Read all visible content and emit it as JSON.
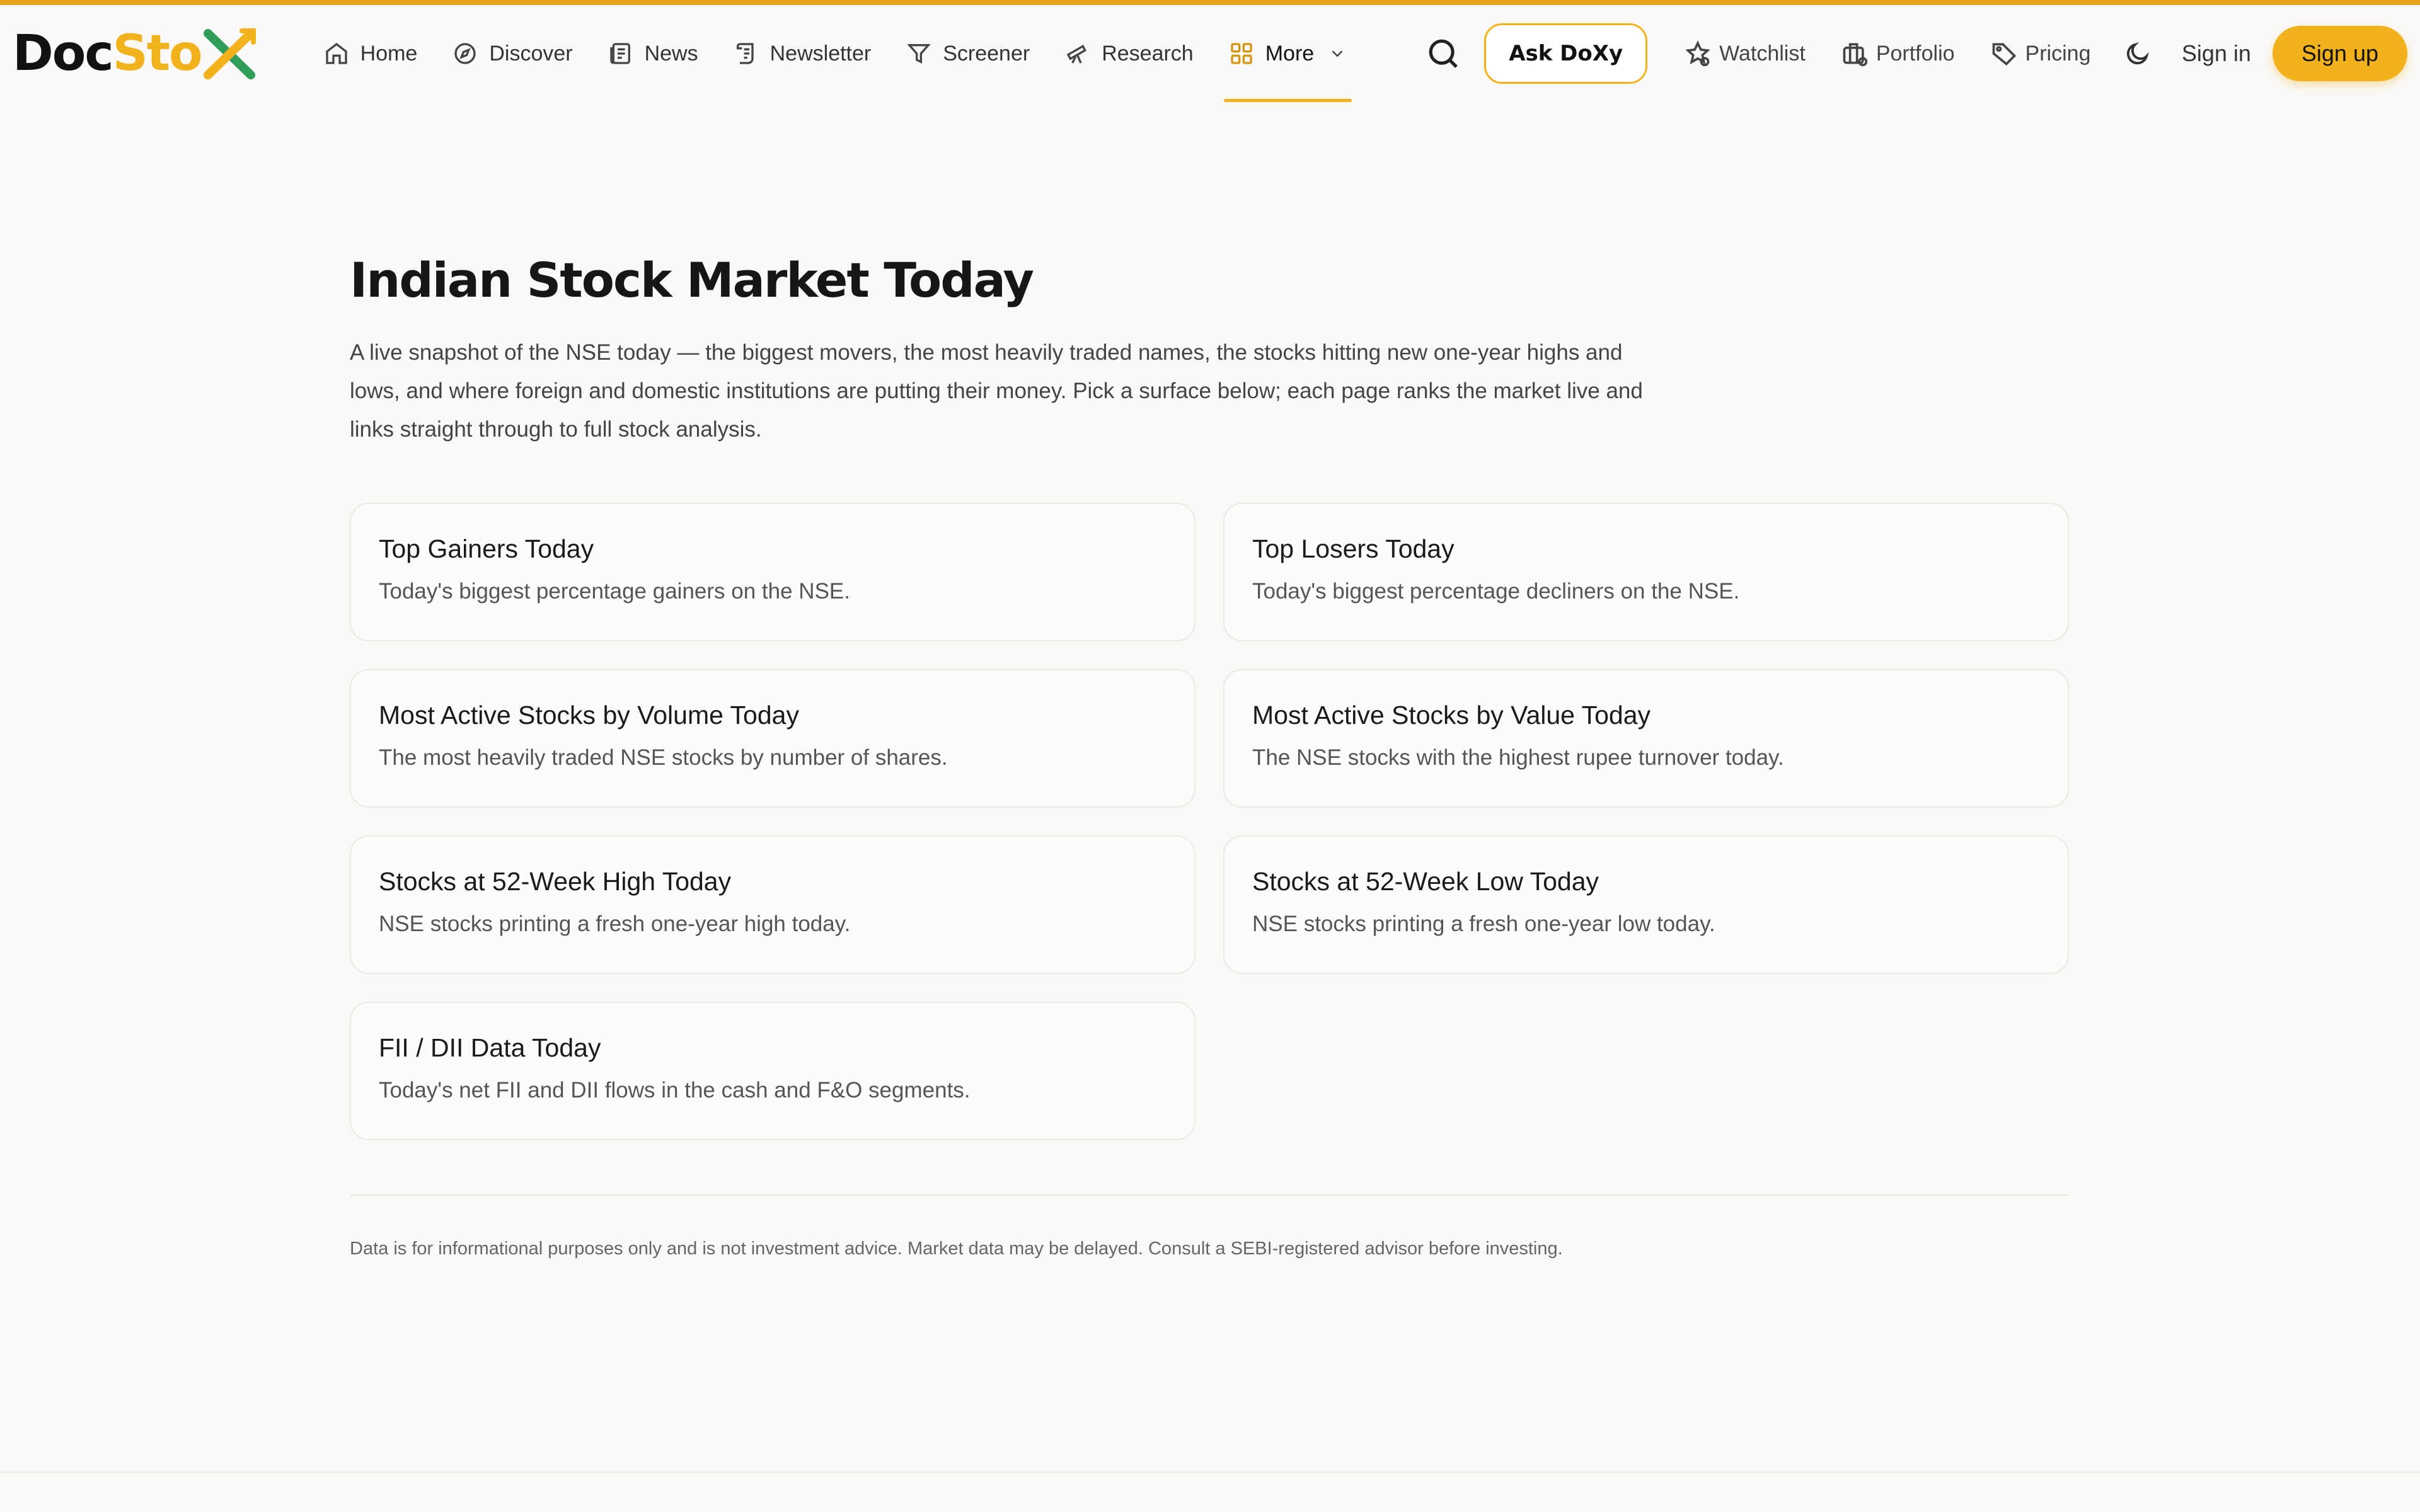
{
  "brand": {
    "part1": "Doc",
    "part2": "Sto",
    "part3": "X",
    "colors": {
      "dark": "#111111",
      "gold": "#f2b21c",
      "green": "#2f9e5a"
    }
  },
  "nav": {
    "items": [
      {
        "label": "Home",
        "icon": "home-icon"
      },
      {
        "label": "Discover",
        "icon": "compass-icon"
      },
      {
        "label": "News",
        "icon": "newspaper-icon"
      },
      {
        "label": "Newsletter",
        "icon": "scroll-icon"
      },
      {
        "label": "Screener",
        "icon": "filter-icon"
      },
      {
        "label": "Research",
        "icon": "telescope-icon"
      },
      {
        "label": "More",
        "icon": "grid-icon",
        "active": true
      }
    ]
  },
  "header": {
    "ask_label": "Ask DoXy",
    "watchlist_label": "Watchlist",
    "portfolio_label": "Portfolio",
    "pricing_label": "Pricing",
    "signin_label": "Sign in",
    "signup_label": "Sign up"
  },
  "page": {
    "title": "Indian Stock Market Today",
    "intro": "A live snapshot of the NSE today — the biggest movers, the most heavily traded names, the stocks hitting new one-year highs and lows, and where foreign and domestic institutions are putting their money. Pick a surface below; each page ranks the market live and links straight through to full stock analysis."
  },
  "cards": [
    {
      "title": "Top Gainers Today",
      "desc": "Today's biggest percentage gainers on the NSE."
    },
    {
      "title": "Top Losers Today",
      "desc": "Today's biggest percentage decliners on the NSE."
    },
    {
      "title": "Most Active Stocks by Volume Today",
      "desc": "The most heavily traded NSE stocks by number of shares."
    },
    {
      "title": "Most Active Stocks by Value Today",
      "desc": "The NSE stocks with the highest rupee turnover today."
    },
    {
      "title": "Stocks at 52-Week High Today",
      "desc": "NSE stocks printing a fresh one-year high today."
    },
    {
      "title": "Stocks at 52-Week Low Today",
      "desc": "NSE stocks printing a fresh one-year low today."
    },
    {
      "title": "FII / DII Data Today",
      "desc": "Today's net FII and DII flows in the cash and F&O segments."
    }
  ],
  "footer": {
    "disclaimer": "Data is for informational purposes only and is not investment advice. Market data may be delayed. Consult a SEBI-registered advisor before investing."
  },
  "accent_color": "#f2b21c"
}
